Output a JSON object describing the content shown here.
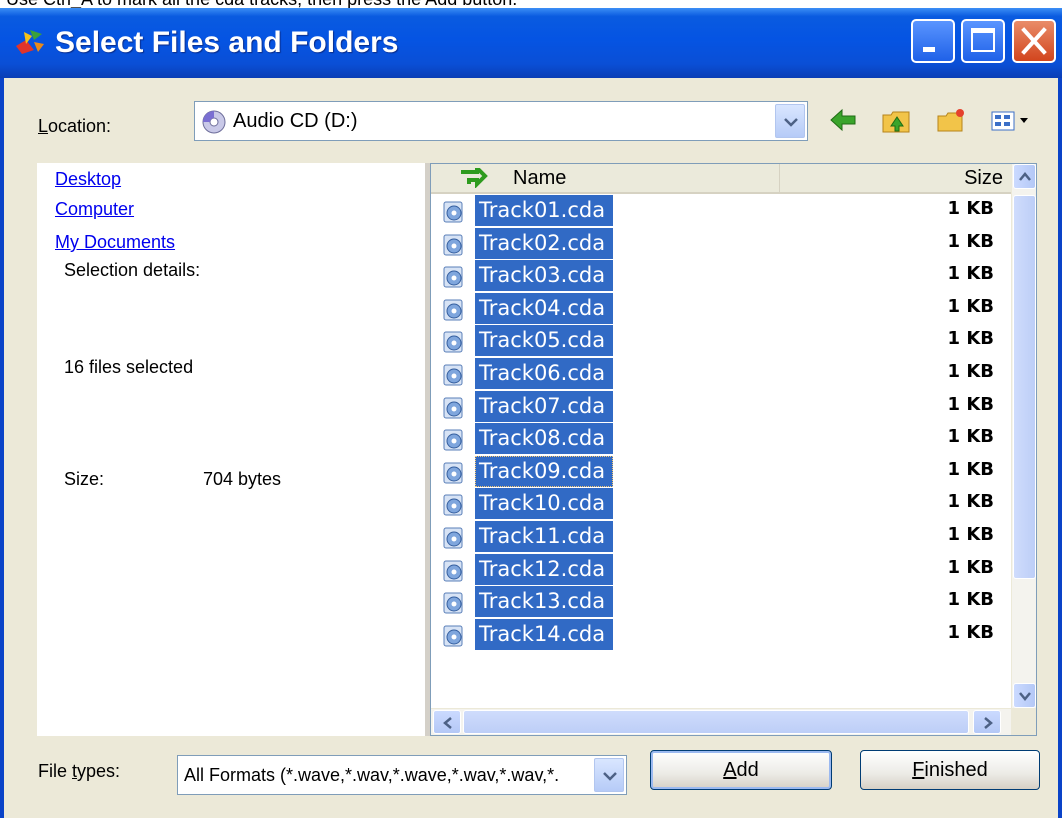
{
  "instruction": "Use Ctrl_A to mark all the cda tracks, then press the Add button.",
  "window": {
    "title": "Select Files and Folders"
  },
  "location": {
    "label_accel": "L",
    "label_rest": "ocation:",
    "value": "Audio CD (D:)"
  },
  "left_pane": {
    "links": [
      "Desktop",
      "Computer",
      "My Documents"
    ],
    "selection_details_label": "Selection details:",
    "selected_count_text": "16 files selected",
    "size_label": "Size:",
    "size_value": "704 bytes"
  },
  "file_list": {
    "columns": {
      "name": "Name",
      "size": "Size"
    },
    "rows": [
      {
        "name": "Track01.cda",
        "size": "1 KB"
      },
      {
        "name": "Track02.cda",
        "size": "1 KB"
      },
      {
        "name": "Track03.cda",
        "size": "1 KB"
      },
      {
        "name": "Track04.cda",
        "size": "1 KB"
      },
      {
        "name": "Track05.cda",
        "size": "1 KB"
      },
      {
        "name": "Track06.cda",
        "size": "1 KB"
      },
      {
        "name": "Track07.cda",
        "size": "1 KB"
      },
      {
        "name": "Track08.cda",
        "size": "1 KB"
      },
      {
        "name": "Track09.cda",
        "size": "1 KB"
      },
      {
        "name": "Track10.cda",
        "size": "1 KB"
      },
      {
        "name": "Track11.cda",
        "size": "1 KB"
      },
      {
        "name": "Track12.cda",
        "size": "1 KB"
      },
      {
        "name": "Track13.cda",
        "size": "1 KB"
      },
      {
        "name": "Track14.cda",
        "size": "1 KB"
      }
    ]
  },
  "file_types": {
    "label_pre": "File ",
    "label_accel": "t",
    "label_rest": "ypes:",
    "value": "All Formats  (*.wave,*.wav,*.wave,*.wav,*.wav,*."
  },
  "buttons": {
    "add_accel": "A",
    "add_rest": "dd",
    "finished_accel": "F",
    "finished_rest": "inished"
  },
  "colors": {
    "selection": "#316ac5",
    "title_bar": "#0554e3",
    "dialog_face": "#ece9d8"
  },
  "icons": {
    "location": "audio-cd-icon",
    "back": "back-arrow-icon",
    "up": "up-folder-icon",
    "new_folder": "new-folder-icon",
    "views": "views-menu-icon",
    "file": "cda-track-icon"
  }
}
